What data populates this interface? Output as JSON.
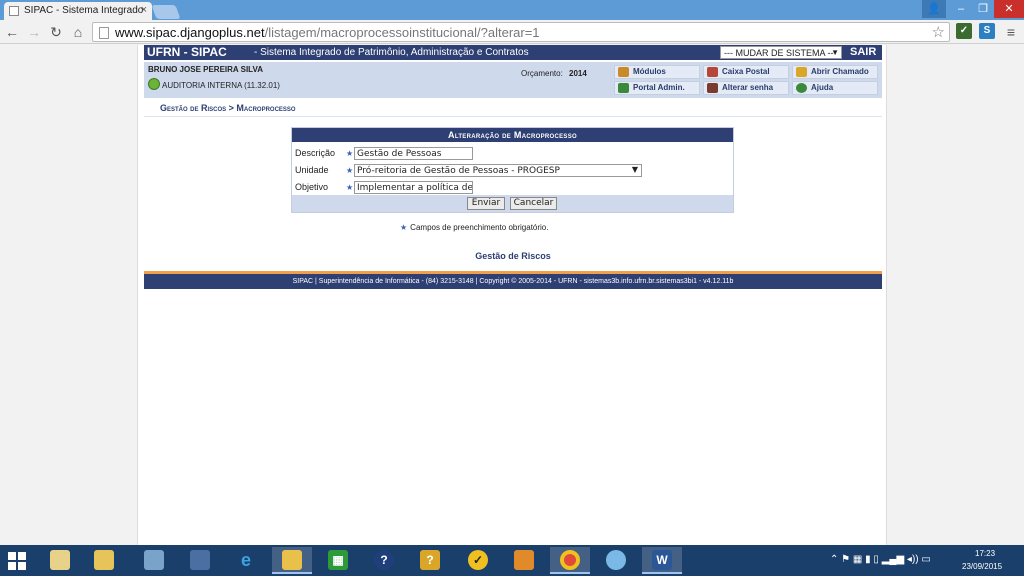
{
  "browser": {
    "tab_title": "SIPAC - Sistema Integrado",
    "url_host": "www.sipac.djangoplus.net",
    "url_path": "/listagem/macroprocessoinstitucional/?alterar=1"
  },
  "header": {
    "brand": "UFRN - SIPAC",
    "system_name": "- Sistema Integrado de Patrimônio, Administração e Contratos",
    "system_select_value": "--- MUDAR DE SISTEMA --",
    "logout": "SAIR"
  },
  "user": {
    "name": "BRUNO JOSE PEREIRA SILVA",
    "unit": "AUDITORIA INTERNA (11.32.01)",
    "budget_label": "Orçamento:",
    "budget_year": "2014"
  },
  "quick_links": [
    {
      "label": "Módulos",
      "icon": "modules-icon",
      "color": "#c98a2a"
    },
    {
      "label": "Caixa Postal",
      "icon": "mailbox-icon",
      "color": "#b4463a"
    },
    {
      "label": "Abrir Chamado",
      "icon": "ticket-icon",
      "color": "#d9a62a"
    },
    {
      "label": "Portal Admin.",
      "icon": "portal-icon",
      "color": "#3b8a3b"
    },
    {
      "label": "Alterar senha",
      "icon": "key-icon",
      "color": "#7a3b2e"
    },
    {
      "label": "Ajuda",
      "icon": "help-icon",
      "color": "#3b8a3b"
    }
  ],
  "breadcrumb": "Gestão de Riscos > Macroprocesso",
  "form": {
    "caption": "Alteraração de Macroprocesso",
    "fields": [
      {
        "label": "Descrição",
        "value": "Gestão de Pessoas"
      },
      {
        "label": "Unidade",
        "value": "Pró-reitoria de Gestão de Pessoas - PROGESP"
      },
      {
        "label": "Objetivo",
        "value": "Implementar a política de g"
      }
    ],
    "submit": "Enviar",
    "cancel": "Cancelar"
  },
  "mandatory_note": "Campos de preenchimento obrigatório.",
  "back_link": "Gestão de Riscos",
  "footer": "SIPAC | Superintendência de Informática - (84) 3215-3148 | Copyright © 2005-2014 - UFRN - sistemas3b.info.ufrn.br.sistemas3bi1 - v4.12.11b",
  "taskbar": {
    "time": "17:23",
    "date": "23/09/2015"
  }
}
